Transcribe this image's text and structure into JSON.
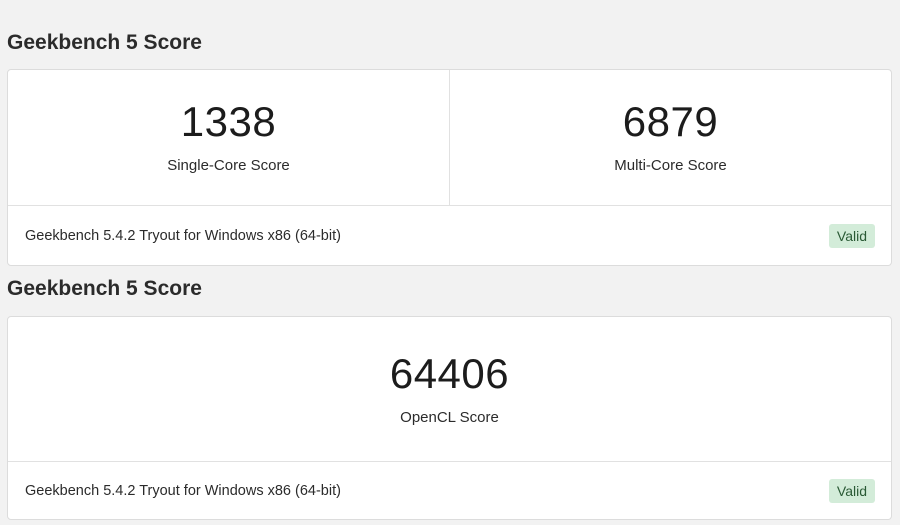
{
  "sections": [
    {
      "title": "Geekbench 5 Score",
      "scores": [
        {
          "value": "1338",
          "label": "Single-Core Score"
        },
        {
          "value": "6879",
          "label": "Multi-Core Score"
        }
      ],
      "footer": {
        "text": "Geekbench 5.4.2 Tryout for Windows x86 (64-bit)",
        "badge": "Valid"
      }
    },
    {
      "title": "Geekbench 5 Score",
      "scores": [
        {
          "value": "64406",
          "label": "OpenCL Score"
        }
      ],
      "footer": {
        "text": "Geekbench 5.4.2 Tryout for Windows x86 (64-bit)",
        "badge": "Valid"
      }
    }
  ],
  "colors": {
    "background": "#f2f2f2",
    "card": "#ffffff",
    "badge_bg": "#d3ecd9",
    "badge_text": "#2a5a35"
  }
}
